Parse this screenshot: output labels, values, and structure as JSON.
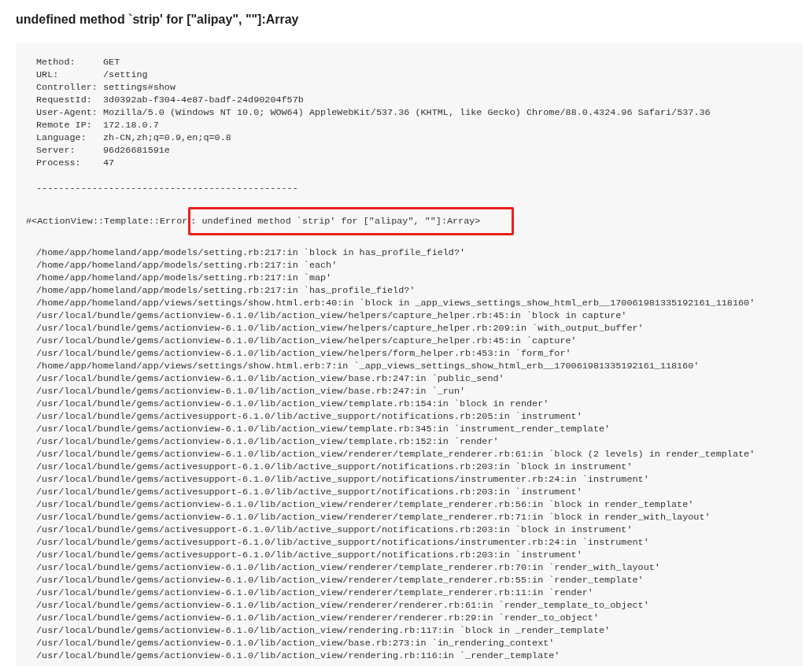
{
  "title": "undefined method `strip' for [\"alipay\", \"\"]:Array",
  "request_info": [
    {
      "label": "Method:",
      "value": "GET"
    },
    {
      "label": "URL:",
      "value": "/setting"
    },
    {
      "label": "Controller:",
      "value": "settings#show"
    },
    {
      "label": "RequestId:",
      "value": "3d0392ab-f304-4e87-badf-24d90204f57b"
    },
    {
      "label": "User-Agent:",
      "value": "Mozilla/5.0 (Windows NT 10.0; WOW64) AppleWebKit/537.36 (KHTML, like Gecko) Chrome/88.0.4324.96 Safari/537.36"
    },
    {
      "label": "Remote IP:",
      "value": "172.18.0.7"
    },
    {
      "label": "Language:",
      "value": "zh-CN,zh;q=0.9,en;q=0.8"
    },
    {
      "label": "Server:",
      "value": "96d26681591e"
    },
    {
      "label": "Process:",
      "value": "47"
    }
  ],
  "separator": "-----------------------------------------------",
  "error": {
    "prefix": "#<ActionView::Template::Error",
    "highlighted": ": undefined method `strip' for [\"alipay\", \"\"]:Array>"
  },
  "backtrace": [
    "/home/app/homeland/app/models/setting.rb:217:in `block in has_profile_field?'",
    "/home/app/homeland/app/models/setting.rb:217:in `each'",
    "/home/app/homeland/app/models/setting.rb:217:in `map'",
    "/home/app/homeland/app/models/setting.rb:217:in `has_profile_field?'",
    "/home/app/homeland/app/views/settings/show.html.erb:40:in `block in _app_views_settings_show_html_erb__170061981335192161_118160'",
    "/usr/local/bundle/gems/actionview-6.1.0/lib/action_view/helpers/capture_helper.rb:45:in `block in capture'",
    "/usr/local/bundle/gems/actionview-6.1.0/lib/action_view/helpers/capture_helper.rb:209:in `with_output_buffer'",
    "/usr/local/bundle/gems/actionview-6.1.0/lib/action_view/helpers/capture_helper.rb:45:in `capture'",
    "/usr/local/bundle/gems/actionview-6.1.0/lib/action_view/helpers/form_helper.rb:453:in `form_for'",
    "/home/app/homeland/app/views/settings/show.html.erb:7:in `_app_views_settings_show_html_erb__170061981335192161_118160'",
    "/usr/local/bundle/gems/actionview-6.1.0/lib/action_view/base.rb:247:in `public_send'",
    "/usr/local/bundle/gems/actionview-6.1.0/lib/action_view/base.rb:247:in `_run'",
    "/usr/local/bundle/gems/actionview-6.1.0/lib/action_view/template.rb:154:in `block in render'",
    "/usr/local/bundle/gems/activesupport-6.1.0/lib/active_support/notifications.rb:205:in `instrument'",
    "/usr/local/bundle/gems/actionview-6.1.0/lib/action_view/template.rb:345:in `instrument_render_template'",
    "/usr/local/bundle/gems/actionview-6.1.0/lib/action_view/template.rb:152:in `render'",
    "/usr/local/bundle/gems/actionview-6.1.0/lib/action_view/renderer/template_renderer.rb:61:in `block (2 levels) in render_template'",
    "/usr/local/bundle/gems/activesupport-6.1.0/lib/active_support/notifications.rb:203:in `block in instrument'",
    "/usr/local/bundle/gems/activesupport-6.1.0/lib/active_support/notifications/instrumenter.rb:24:in `instrument'",
    "/usr/local/bundle/gems/activesupport-6.1.0/lib/active_support/notifications.rb:203:in `instrument'",
    "/usr/local/bundle/gems/actionview-6.1.0/lib/action_view/renderer/template_renderer.rb:56:in `block in render_template'",
    "/usr/local/bundle/gems/actionview-6.1.0/lib/action_view/renderer/template_renderer.rb:71:in `block in render_with_layout'",
    "/usr/local/bundle/gems/activesupport-6.1.0/lib/active_support/notifications.rb:203:in `block in instrument'",
    "/usr/local/bundle/gems/activesupport-6.1.0/lib/active_support/notifications/instrumenter.rb:24:in `instrument'",
    "/usr/local/bundle/gems/activesupport-6.1.0/lib/active_support/notifications.rb:203:in `instrument'",
    "/usr/local/bundle/gems/actionview-6.1.0/lib/action_view/renderer/template_renderer.rb:70:in `render_with_layout'",
    "/usr/local/bundle/gems/actionview-6.1.0/lib/action_view/renderer/template_renderer.rb:55:in `render_template'",
    "/usr/local/bundle/gems/actionview-6.1.0/lib/action_view/renderer/template_renderer.rb:11:in `render'",
    "/usr/local/bundle/gems/actionview-6.1.0/lib/action_view/renderer/renderer.rb:61:in `render_template_to_object'",
    "/usr/local/bundle/gems/actionview-6.1.0/lib/action_view/renderer/renderer.rb:29:in `render_to_object'",
    "/usr/local/bundle/gems/actionview-6.1.0/lib/action_view/rendering.rb:117:in `block in _render_template'",
    "/usr/local/bundle/gems/actionview-6.1.0/lib/action_view/base.rb:273:in `in_rendering_context'",
    "/usr/local/bundle/gems/actionview-6.1.0/lib/action_view/rendering.rb:116:in `_render_template'"
  ]
}
